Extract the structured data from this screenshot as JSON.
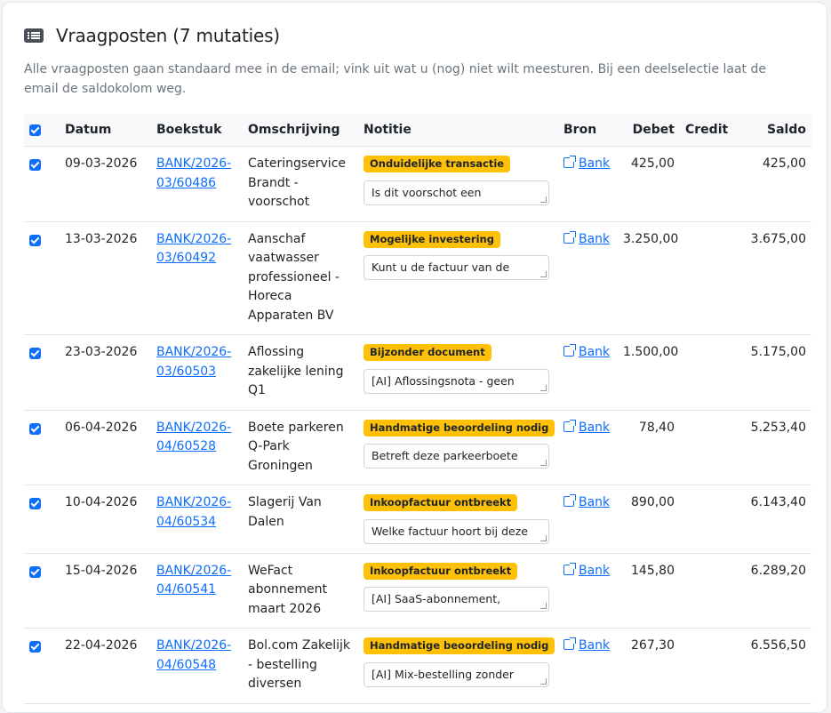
{
  "header": {
    "icon": "list-icon",
    "title": "Vraagposten (7 mutaties)"
  },
  "intro": "Alle vraagposten gaan standaard mee in de email; vink uit wat u (nog) niet wilt meesturen. Bij een deelselectie laat de email de saldokolom weg.",
  "table": {
    "columns": {
      "datum": "Datum",
      "boekstuk": "Boekstuk",
      "omschrijving": "Omschrijving",
      "notitie": "Notitie",
      "bron": "Bron",
      "debet": "Debet",
      "credit": "Credit",
      "saldo": "Saldo"
    },
    "select_all_checked": true,
    "rows": [
      {
        "checked": true,
        "datum": "09-03-2026",
        "boekstuk": "BANK/2026-03/60486",
        "omschrijving": "Cateringservice Brandt - voorschot",
        "badge": "Onduidelijke transactie",
        "notitie": "Is dit voorschot een",
        "bron": "Bank",
        "debet": "425,00",
        "credit": "",
        "saldo": "425,00"
      },
      {
        "checked": true,
        "datum": "13-03-2026",
        "boekstuk": "BANK/2026-03/60492",
        "omschrijving": "Aanschaf vaatwasser professioneel - Horeca Apparaten BV",
        "badge": "Mogelijke investering",
        "notitie": "Kunt u de factuur van de",
        "bron": "Bank",
        "debet": "3.250,00",
        "credit": "",
        "saldo": "3.675,00"
      },
      {
        "checked": true,
        "datum": "23-03-2026",
        "boekstuk": "BANK/2026-03/60503",
        "omschrijving": "Aflossing zakelijke lening Q1",
        "badge": "Bijzonder document",
        "notitie": "[AI] Aflossingsnota - geen",
        "bron": "Bank",
        "debet": "1.500,00",
        "credit": "",
        "saldo": "5.175,00"
      },
      {
        "checked": true,
        "datum": "06-04-2026",
        "boekstuk": "BANK/2026-04/60528",
        "omschrijving": "Boete parkeren Q-Park Groningen",
        "badge": "Handmatige beoordeling nodig",
        "notitie": "Betreft deze parkeerboete",
        "bron": "Bank",
        "debet": "78,40",
        "credit": "",
        "saldo": "5.253,40"
      },
      {
        "checked": true,
        "datum": "10-04-2026",
        "boekstuk": "BANK/2026-04/60534",
        "omschrijving": "Slagerij Van Dalen",
        "badge": "Inkoopfactuur ontbreekt",
        "notitie": "Welke factuur hoort bij deze",
        "bron": "Bank",
        "debet": "890,00",
        "credit": "",
        "saldo": "6.143,40"
      },
      {
        "checked": true,
        "datum": "15-04-2026",
        "boekstuk": "BANK/2026-04/60541",
        "omschrijving": "WeFact abonnement maart 2026",
        "badge": "Inkoopfactuur ontbreekt",
        "notitie": "[AI] SaaS-abonnement,",
        "bron": "Bank",
        "debet": "145,80",
        "credit": "",
        "saldo": "6.289,20"
      },
      {
        "checked": true,
        "datum": "22-04-2026",
        "boekstuk": "BANK/2026-04/60548",
        "omschrijving": "Bol.com Zakelijk - bestelling diversen",
        "badge": "Handmatige beoordeling nodig",
        "notitie": "[AI] Mix-bestelling zonder",
        "bron": "Bank",
        "debet": "267,30",
        "credit": "",
        "saldo": "6.556,50"
      }
    ]
  },
  "colors": {
    "accent": "#0d6efd",
    "badge": "#ffc107"
  }
}
